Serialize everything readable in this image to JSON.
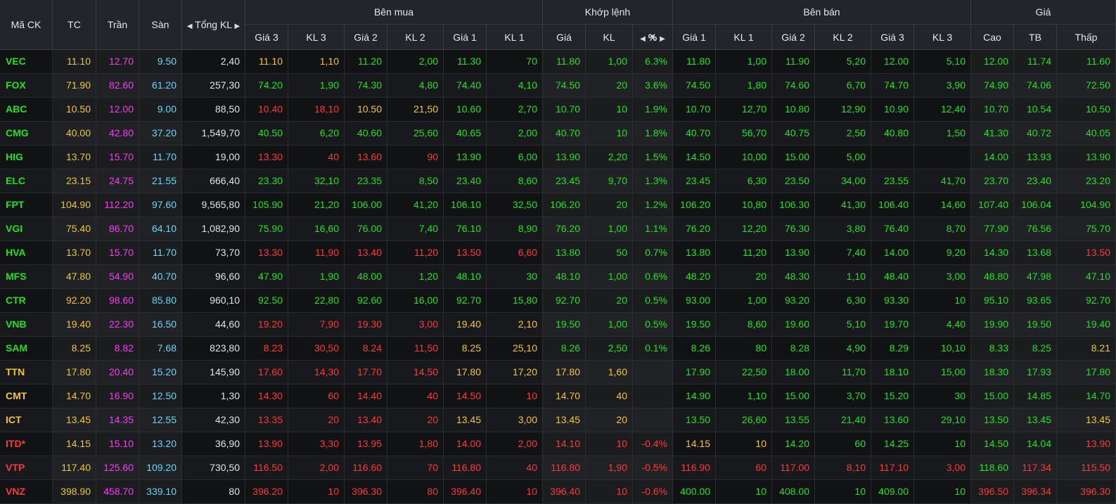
{
  "header": {
    "ma_ck": "Mã CK",
    "tc": "TC",
    "tran": "Trần",
    "san": "Sàn",
    "tong_kl": "Tổng KL",
    "ben_mua": "Bên mua",
    "khop_lenh": "Khớp lệnh",
    "ben_ban": "Bên bán",
    "gia": "Giá",
    "gia3": "Giá 3",
    "kl3": "KL 3",
    "gia2": "Giá 2",
    "kl2": "KL 2",
    "gia1": "Giá 1",
    "kl1": "KL 1",
    "kgia": "Giá",
    "kkl": "KL",
    "kpct": "%",
    "cao": "Cao",
    "tb": "TB",
    "thap": "Thấp",
    "left_arrow_icon": "triangle-left-icon",
    "right_arrow_icon": "triangle-right-icon",
    "sort_down_icon": "triangle-down-icon"
  },
  "colors": {
    "up": "#1de31d",
    "down": "#ff3737",
    "ref": "#f3c52c",
    "ceiling": "#f33cf0",
    "floor": "#5fd9ff",
    "neutral": "#e2e2e2"
  },
  "rows": [
    {
      "sym": "VEC",
      "tc": "11.10",
      "tran": "12.70",
      "san": "9.50",
      "tong": "2,40",
      "b_g3": "11.10",
      "b_k3": "1,10",
      "b_g2": "11.20",
      "b_k2": "2,00",
      "b_g1": "11.30",
      "b_k1": "70",
      "k_g": "11.80",
      "k_kl": "1,00",
      "k_p": "6.3%",
      "s_g1": "11.80",
      "s_k1": "1,00",
      "s_g2": "11.90",
      "s_k2": "5,20",
      "s_g3": "12.00",
      "s_k3": "5,10",
      "cao": "12.00",
      "tb": "11.74",
      "thap": "11.60"
    },
    {
      "sym": "FOX",
      "tc": "71.90",
      "tran": "82.60",
      "san": "61.20",
      "tong": "257,30",
      "b_g3": "74.20",
      "b_k3": "1,90",
      "b_g2": "74.30",
      "b_k2": "4,80",
      "b_g1": "74.40",
      "b_k1": "4,10",
      "k_g": "74.50",
      "k_kl": "20",
      "k_p": "3.6%",
      "s_g1": "74.50",
      "s_k1": "1,80",
      "s_g2": "74.60",
      "s_k2": "6,70",
      "s_g3": "74.70",
      "s_k3": "3,90",
      "cao": "74.90",
      "tb": "74.06",
      "thap": "72.50"
    },
    {
      "sym": "ABC",
      "tc": "10.50",
      "tran": "12.00",
      "san": "9.00",
      "tong": "88,50",
      "b_g3": "10.40",
      "b_k3": "18,10",
      "b_g2": "10.50",
      "b_k2": "21,50",
      "b_g1": "10.60",
      "b_k1": "2,70",
      "k_g": "10.70",
      "k_kl": "10",
      "k_p": "1.9%",
      "s_g1": "10.70",
      "s_k1": "12,70",
      "s_g2": "10.80",
      "s_k2": "12,90",
      "s_g3": "10.90",
      "s_k3": "12,40",
      "cao": "10.70",
      "tb": "10.54",
      "thap": "10.50"
    },
    {
      "sym": "CMG",
      "tc": "40.00",
      "tran": "42.80",
      "san": "37.20",
      "tong": "1,549,70",
      "b_g3": "40.50",
      "b_k3": "6,20",
      "b_g2": "40.60",
      "b_k2": "25,60",
      "b_g1": "40.65",
      "b_k1": "2,00",
      "k_g": "40.70",
      "k_kl": "10",
      "k_p": "1.8%",
      "s_g1": "40.70",
      "s_k1": "56,70",
      "s_g2": "40.75",
      "s_k2": "2,50",
      "s_g3": "40.80",
      "s_k3": "1,50",
      "cao": "41.30",
      "tb": "40.72",
      "thap": "40.05"
    },
    {
      "sym": "HIG",
      "tc": "13.70",
      "tran": "15.70",
      "san": "11.70",
      "tong": "19,00",
      "b_g3": "13.30",
      "b_k3": "40",
      "b_g2": "13.60",
      "b_k2": "90",
      "b_g1": "13.90",
      "b_k1": "6,00",
      "k_g": "13.90",
      "k_kl": "2,20",
      "k_p": "1.5%",
      "s_g1": "14.50",
      "s_k1": "10,00",
      "s_g2": "15.00",
      "s_k2": "5,00",
      "s_g3": "",
      "s_k3": "",
      "cao": "14.00",
      "tb": "13.93",
      "thap": "13.90"
    },
    {
      "sym": "ELC",
      "tc": "23.15",
      "tran": "24.75",
      "san": "21.55",
      "tong": "666,40",
      "b_g3": "23.30",
      "b_k3": "32,10",
      "b_g2": "23.35",
      "b_k2": "8,50",
      "b_g1": "23.40",
      "b_k1": "8,60",
      "k_g": "23.45",
      "k_kl": "9,70",
      "k_p": "1.3%",
      "s_g1": "23.45",
      "s_k1": "6,30",
      "s_g2": "23.50",
      "s_k2": "34,00",
      "s_g3": "23.55",
      "s_k3": "41,70",
      "cao": "23.70",
      "tb": "23.40",
      "thap": "23.20"
    },
    {
      "sym": "FPT",
      "tc": "104.90",
      "tran": "112.20",
      "san": "97.60",
      "tong": "9,565,80",
      "b_g3": "105.90",
      "b_k3": "21,20",
      "b_g2": "106.00",
      "b_k2": "41,20",
      "b_g1": "106.10",
      "b_k1": "32,50",
      "k_g": "106.20",
      "k_kl": "20",
      "k_p": "1.2%",
      "s_g1": "106.20",
      "s_k1": "10,80",
      "s_g2": "106.30",
      "s_k2": "41,30",
      "s_g3": "106.40",
      "s_k3": "14,60",
      "cao": "107.40",
      "tb": "106.04",
      "thap": "104.90"
    },
    {
      "sym": "VGI",
      "tc": "75.40",
      "tran": "86.70",
      "san": "64.10",
      "tong": "1,082,90",
      "b_g3": "75.90",
      "b_k3": "16,60",
      "b_g2": "76.00",
      "b_k2": "7,40",
      "b_g1": "76.10",
      "b_k1": "8,90",
      "k_g": "76.20",
      "k_kl": "1,00",
      "k_p": "1.1%",
      "s_g1": "76.20",
      "s_k1": "12,20",
      "s_g2": "76.30",
      "s_k2": "3,80",
      "s_g3": "76.40",
      "s_k3": "8,70",
      "cao": "77.90",
      "tb": "76.56",
      "thap": "75.70"
    },
    {
      "sym": "HVA",
      "tc": "13.70",
      "tran": "15.70",
      "san": "11.70",
      "tong": "73,70",
      "b_g3": "13.30",
      "b_k3": "11,90",
      "b_g2": "13.40",
      "b_k2": "11,20",
      "b_g1": "13.50",
      "b_k1": "6,60",
      "k_g": "13.80",
      "k_kl": "50",
      "k_p": "0.7%",
      "s_g1": "13.80",
      "s_k1": "11,20",
      "s_g2": "13.90",
      "s_k2": "7,40",
      "s_g3": "14.00",
      "s_k3": "9,20",
      "cao": "14.30",
      "tb": "13.68",
      "thap": "13.50"
    },
    {
      "sym": "MFS",
      "tc": "47.80",
      "tran": "54.90",
      "san": "40.70",
      "tong": "96,60",
      "b_g3": "47.90",
      "b_k3": "1,90",
      "b_g2": "48.00",
      "b_k2": "1,20",
      "b_g1": "48.10",
      "b_k1": "30",
      "k_g": "48.10",
      "k_kl": "1,00",
      "k_p": "0.6%",
      "s_g1": "48.20",
      "s_k1": "20",
      "s_g2": "48.30",
      "s_k2": "1,10",
      "s_g3": "48.40",
      "s_k3": "3,00",
      "cao": "48.80",
      "tb": "47.98",
      "thap": "47.10"
    },
    {
      "sym": "CTR",
      "tc": "92.20",
      "tran": "98.60",
      "san": "85.80",
      "tong": "960,10",
      "b_g3": "92.50",
      "b_k3": "22,80",
      "b_g2": "92.60",
      "b_k2": "16,00",
      "b_g1": "92.70",
      "b_k1": "15,80",
      "k_g": "92.70",
      "k_kl": "20",
      "k_p": "0.5%",
      "s_g1": "93.00",
      "s_k1": "1,00",
      "s_g2": "93.20",
      "s_k2": "6,30",
      "s_g3": "93.30",
      "s_k3": "10",
      "cao": "95.10",
      "tb": "93.65",
      "thap": "92.70"
    },
    {
      "sym": "VNB",
      "tc": "19.40",
      "tran": "22.30",
      "san": "16.50",
      "tong": "44,60",
      "b_g3": "19.20",
      "b_k3": "7,90",
      "b_g2": "19.30",
      "b_k2": "3,00",
      "b_g1": "19.40",
      "b_k1": "2,10",
      "k_g": "19.50",
      "k_kl": "1,00",
      "k_p": "0.5%",
      "s_g1": "19.50",
      "s_k1": "8,60",
      "s_g2": "19.60",
      "s_k2": "5,10",
      "s_g3": "19.70",
      "s_k3": "4,40",
      "cao": "19.90",
      "tb": "19.50",
      "thap": "19.40"
    },
    {
      "sym": "SAM",
      "tc": "8.25",
      "tran": "8.82",
      "san": "7.68",
      "tong": "823,80",
      "b_g3": "8.23",
      "b_k3": "30,50",
      "b_g2": "8.24",
      "b_k2": "11,50",
      "b_g1": "8.25",
      "b_k1": "25,10",
      "k_g": "8.26",
      "k_kl": "2,50",
      "k_p": "0.1%",
      "s_g1": "8.26",
      "s_k1": "80",
      "s_g2": "8.28",
      "s_k2": "4,90",
      "s_g3": "8.29",
      "s_k3": "10,10",
      "cao": "8.33",
      "tb": "8.25",
      "thap": "8.21"
    },
    {
      "sym": "TTN",
      "tc": "17.80",
      "tran": "20.40",
      "san": "15.20",
      "tong": "145,90",
      "b_g3": "17.60",
      "b_k3": "14,30",
      "b_g2": "17.70",
      "b_k2": "14,50",
      "b_g1": "17.80",
      "b_k1": "17,20",
      "k_g": "17.80",
      "k_kl": "1,60",
      "k_p": "",
      "s_g1": "17.90",
      "s_k1": "22,50",
      "s_g2": "18.00",
      "s_k2": "11,70",
      "s_g3": "18.10",
      "s_k3": "15,00",
      "cao": "18.30",
      "tb": "17.93",
      "thap": "17.80"
    },
    {
      "sym": "CMT",
      "tc": "14.70",
      "tran": "16.90",
      "san": "12.50",
      "tong": "1,30",
      "b_g3": "14.30",
      "b_k3": "60",
      "b_g2": "14.40",
      "b_k2": "40",
      "b_g1": "14.50",
      "b_k1": "10",
      "k_g": "14.70",
      "k_kl": "40",
      "k_p": "",
      "s_g1": "14.90",
      "s_k1": "1,10",
      "s_g2": "15.00",
      "s_k2": "3,70",
      "s_g3": "15.20",
      "s_k3": "30",
      "cao": "15.00",
      "tb": "14.85",
      "thap": "14.70"
    },
    {
      "sym": "ICT",
      "tc": "13.45",
      "tran": "14.35",
      "san": "12.55",
      "tong": "42,30",
      "b_g3": "13.35",
      "b_k3": "20",
      "b_g2": "13.40",
      "b_k2": "20",
      "b_g1": "13.45",
      "b_k1": "3,00",
      "k_g": "13.45",
      "k_kl": "20",
      "k_p": "",
      "s_g1": "13.50",
      "s_k1": "26,60",
      "s_g2": "13.55",
      "s_k2": "21,40",
      "s_g3": "13.60",
      "s_k3": "29,10",
      "cao": "13.50",
      "tb": "13.45",
      "thap": "13.45"
    },
    {
      "sym": "ITD*",
      "tc": "14.15",
      "tran": "15.10",
      "san": "13.20",
      "tong": "36,90",
      "b_g3": "13.90",
      "b_k3": "3,30",
      "b_g2": "13.95",
      "b_k2": "1,80",
      "b_g1": "14.00",
      "b_k1": "2,00",
      "k_g": "14.10",
      "k_kl": "10",
      "k_p": "-0.4%",
      "s_g1": "14.15",
      "s_k1": "10",
      "s_g2": "14.20",
      "s_k2": "60",
      "s_g3": "14.25",
      "s_k3": "10",
      "cao": "14.50",
      "tb": "14.04",
      "thap": "13.90"
    },
    {
      "sym": "VTP",
      "tc": "117.40",
      "tran": "125.60",
      "san": "109.20",
      "tong": "730,50",
      "b_g3": "116.50",
      "b_k3": "2,00",
      "b_g2": "116.60",
      "b_k2": "70",
      "b_g1": "116.80",
      "b_k1": "40",
      "k_g": "116.80",
      "k_kl": "1,90",
      "k_p": "-0.5%",
      "s_g1": "116.90",
      "s_k1": "60",
      "s_g2": "117.00",
      "s_k2": "8,10",
      "s_g3": "117.10",
      "s_k3": "3,00",
      "cao": "118.60",
      "tb": "117.34",
      "thap": "115.50"
    },
    {
      "sym": "VNZ",
      "tc": "398.90",
      "tran": "458.70",
      "san": "339.10",
      "tong": "80",
      "b_g3": "396.20",
      "b_k3": "10",
      "b_g2": "396.30",
      "b_k2": "80",
      "b_g1": "396.40",
      "b_k1": "10",
      "k_g": "396.40",
      "k_kl": "10",
      "k_p": "-0.6%",
      "s_g1": "400.00",
      "s_k1": "10",
      "s_g2": "408.00",
      "s_k2": "10",
      "s_g3": "409.00",
      "s_k3": "10",
      "cao": "396.50",
      "tb": "396.34",
      "thap": "396.30"
    }
  ],
  "row_colors": [
    [
      "g",
      "y",
      "p",
      "c",
      "w",
      "y",
      "y",
      "g",
      "g",
      "g",
      "g",
      "g",
      "g",
      "g",
      "g",
      "g",
      "g",
      "g",
      "g",
      "g",
      "g",
      "g",
      "g",
      "g"
    ],
    [
      "g",
      "y",
      "p",
      "c",
      "w",
      "g",
      "g",
      "g",
      "g",
      "g",
      "g",
      "g",
      "g",
      "g",
      "g",
      "g",
      "g",
      "g",
      "g",
      "g",
      "g",
      "g",
      "g",
      "g"
    ],
    [
      "g",
      "y",
      "p",
      "c",
      "w",
      "r",
      "r",
      "y",
      "y",
      "g",
      "g",
      "g",
      "g",
      "g",
      "g",
      "g",
      "g",
      "g",
      "g",
      "g",
      "g",
      "g",
      "g",
      "y"
    ],
    [
      "g",
      "y",
      "p",
      "c",
      "w",
      "g",
      "g",
      "g",
      "g",
      "g",
      "g",
      "g",
      "g",
      "g",
      "g",
      "g",
      "g",
      "g",
      "g",
      "g",
      "g",
      "g",
      "g",
      "g"
    ],
    [
      "g",
      "y",
      "p",
      "c",
      "w",
      "r",
      "r",
      "r",
      "r",
      "g",
      "g",
      "g",
      "g",
      "g",
      "g",
      "g",
      "g",
      "g",
      "g",
      "g",
      "g",
      "g",
      "g",
      "g"
    ],
    [
      "g",
      "y",
      "p",
      "c",
      "w",
      "g",
      "g",
      "g",
      "g",
      "g",
      "g",
      "g",
      "g",
      "g",
      "g",
      "g",
      "g",
      "g",
      "g",
      "g",
      "g",
      "g",
      "g",
      "g"
    ],
    [
      "g",
      "y",
      "p",
      "c",
      "w",
      "g",
      "g",
      "g",
      "g",
      "g",
      "g",
      "g",
      "g",
      "g",
      "g",
      "g",
      "g",
      "g",
      "g",
      "g",
      "g",
      "g",
      "g",
      "y"
    ],
    [
      "g",
      "y",
      "p",
      "c",
      "w",
      "g",
      "g",
      "g",
      "g",
      "g",
      "g",
      "g",
      "g",
      "g",
      "g",
      "g",
      "g",
      "g",
      "g",
      "g",
      "g",
      "g",
      "g",
      "g"
    ],
    [
      "g",
      "y",
      "p",
      "c",
      "w",
      "r",
      "r",
      "r",
      "r",
      "r",
      "r",
      "g",
      "g",
      "g",
      "g",
      "g",
      "g",
      "g",
      "g",
      "g",
      "g",
      "g",
      "r",
      "r"
    ],
    [
      "g",
      "y",
      "p",
      "c",
      "w",
      "g",
      "g",
      "g",
      "g",
      "g",
      "g",
      "g",
      "g",
      "g",
      "g",
      "g",
      "g",
      "g",
      "g",
      "g",
      "g",
      "g",
      "g",
      "r"
    ],
    [
      "g",
      "y",
      "p",
      "c",
      "w",
      "g",
      "g",
      "g",
      "g",
      "g",
      "g",
      "g",
      "g",
      "g",
      "g",
      "g",
      "g",
      "g",
      "g",
      "g",
      "g",
      "g",
      "g",
      "g"
    ],
    [
      "g",
      "y",
      "p",
      "c",
      "w",
      "r",
      "r",
      "r",
      "r",
      "y",
      "y",
      "g",
      "g",
      "g",
      "g",
      "g",
      "g",
      "g",
      "g",
      "g",
      "g",
      "g",
      "g",
      "y"
    ],
    [
      "g",
      "y",
      "p",
      "c",
      "w",
      "r",
      "r",
      "r",
      "r",
      "y",
      "y",
      "g",
      "g",
      "g",
      "g",
      "g",
      "g",
      "g",
      "g",
      "g",
      "g",
      "g",
      "y",
      "r"
    ],
    [
      "y",
      "y",
      "p",
      "c",
      "w",
      "r",
      "r",
      "r",
      "r",
      "y",
      "y",
      "y",
      "y",
      "y",
      "g",
      "g",
      "g",
      "g",
      "g",
      "g",
      "g",
      "g",
      "g",
      "y"
    ],
    [
      "y",
      "y",
      "p",
      "c",
      "w",
      "r",
      "r",
      "r",
      "r",
      "r",
      "r",
      "y",
      "y",
      "y",
      "g",
      "g",
      "g",
      "g",
      "g",
      "g",
      "g",
      "g",
      "g",
      "y"
    ],
    [
      "y",
      "y",
      "p",
      "c",
      "w",
      "r",
      "r",
      "r",
      "r",
      "y",
      "y",
      "y",
      "y",
      "y",
      "g",
      "g",
      "g",
      "g",
      "g",
      "g",
      "g",
      "g",
      "y",
      "y"
    ],
    [
      "r",
      "y",
      "p",
      "c",
      "w",
      "r",
      "r",
      "r",
      "r",
      "r",
      "r",
      "r",
      "r",
      "r",
      "y",
      "y",
      "g",
      "g",
      "g",
      "g",
      "g",
      "g",
      "r",
      "r"
    ],
    [
      "r",
      "y",
      "p",
      "c",
      "w",
      "r",
      "r",
      "r",
      "r",
      "r",
      "r",
      "r",
      "r",
      "r",
      "r",
      "r",
      "r",
      "r",
      "r",
      "r",
      "g",
      "r",
      "r",
      "r"
    ],
    [
      "r",
      "y",
      "p",
      "c",
      "w",
      "r",
      "r",
      "r",
      "r",
      "r",
      "r",
      "r",
      "r",
      "r",
      "g",
      "g",
      "g",
      "g",
      "g",
      "g",
      "r",
      "r",
      "r",
      "r"
    ]
  ]
}
